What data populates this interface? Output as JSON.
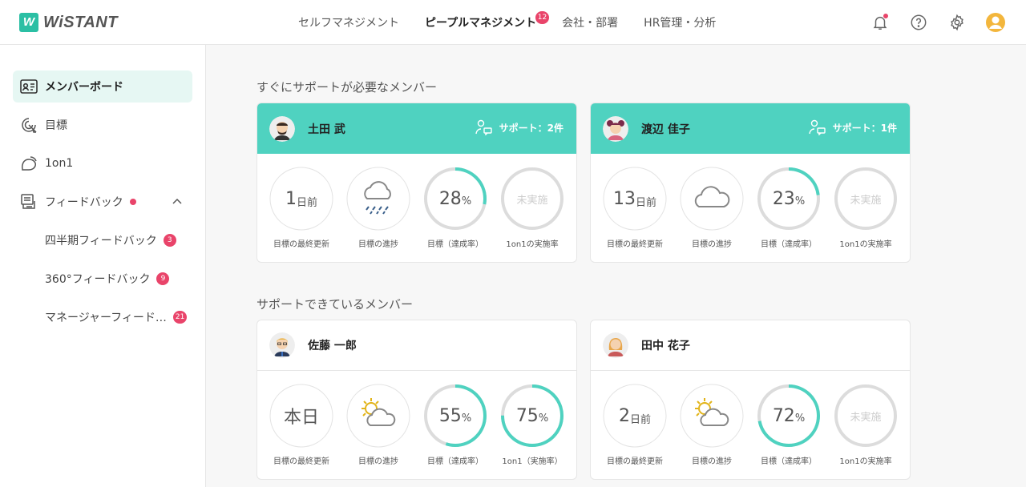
{
  "header": {
    "logo_mark": "W",
    "logo_text": "WiSTANT",
    "nav": [
      {
        "label": "セルフマネジメント"
      },
      {
        "label": "ピープルマネジメント",
        "badge": "12"
      },
      {
        "label": "会社・部署"
      },
      {
        "label": "HR管理・分析"
      }
    ],
    "icons": [
      "bell-icon",
      "help-icon",
      "gear-icon",
      "user-avatar-icon"
    ]
  },
  "sidebar": {
    "items": [
      {
        "label": "メンバーボード",
        "icon": "id-card-icon",
        "active": true
      },
      {
        "label": "目標",
        "icon": "target-icon"
      },
      {
        "label": "1on1",
        "icon": "chat-icon"
      },
      {
        "label": "フィードバック",
        "icon": "feedback-icon"
      }
    ],
    "sub_items": [
      {
        "label": "四半期フィードバック",
        "count": "3"
      },
      {
        "label": "360°フィードバック",
        "count": "9"
      },
      {
        "label": "マネージャーフィード…",
        "count": "21"
      }
    ]
  },
  "main": {
    "section1_title": "すぐにサポートが必要なメンバー",
    "section2_title": "サポートできているメンバー",
    "captions": {
      "last_update": "目標の最終更新",
      "progress": "目標の進捗",
      "achievement": "目標（達成率）",
      "oneonone_rate": "1on1の実施率",
      "oneonone_rate_alt": "1on1（実施率）"
    },
    "not_done": "未実施",
    "day_unit": "日前",
    "percent_unit": "%",
    "cards": [
      {
        "name": "土田 武",
        "support": "サポート：2件",
        "last_update_num": "1",
        "weather": "rain",
        "achievement": "28",
        "achievement_fraction": 0.28,
        "oneonone": null
      },
      {
        "name": "渡辺 佳子",
        "support": "サポート：1件",
        "last_update_num": "13",
        "weather": "cloud",
        "achievement": "23",
        "achievement_fraction": 0.23,
        "oneonone": null
      },
      {
        "name": "佐藤 一郎",
        "last_update_text": "本日",
        "weather": "sun-cloud",
        "achievement": "55",
        "achievement_fraction": 0.55,
        "oneonone": "75",
        "oneonone_fraction": 0.75
      },
      {
        "name": "田中 花子",
        "last_update_num": "2",
        "weather": "sun-cloud",
        "achievement": "72",
        "achievement_fraction": 0.72,
        "oneonone": null
      }
    ]
  },
  "colors": {
    "accent": "#4fd2c0",
    "badge": "#e9446a",
    "ring_bg": "#dcdcdc"
  }
}
